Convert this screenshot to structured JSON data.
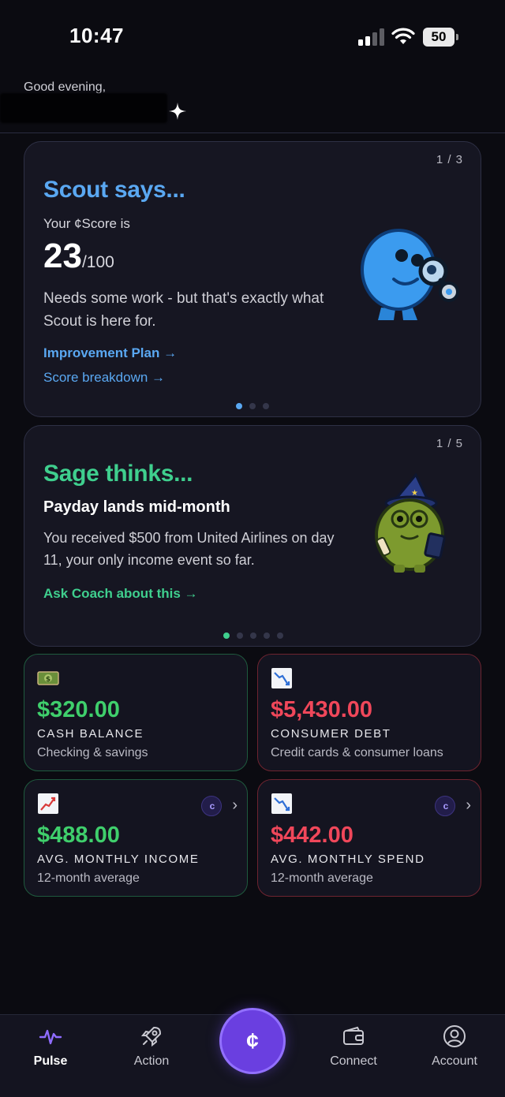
{
  "status_bar": {
    "time": "10:47",
    "battery": "50"
  },
  "header": {
    "greeting": "Good evening,"
  },
  "scout_card": {
    "counter": "1 / 3",
    "heading": "Scout says...",
    "score_label": "Your ¢Score is",
    "score_value": "23",
    "score_max": "/100",
    "description": "Needs some work - but that's exactly what Scout is here for.",
    "link_plan": "Improvement Plan →",
    "link_breakdown": "Score breakdown →",
    "accent": "#5aa8f2"
  },
  "sage_card": {
    "counter": "1 / 5",
    "heading": "Sage thinks...",
    "subtitle": "Payday lands mid-month",
    "description": "You received $500 from United Airlines on day 11, your only income event so far.",
    "link": "Ask Coach about this →",
    "accent": "#3fcf8e"
  },
  "stats": [
    {
      "icon": "money-icon",
      "value": "$320.00",
      "title": "CASH BALANCE",
      "subtitle": "Checking & savings"
    },
    {
      "icon": "chart-decreasing-icon",
      "value": "$5,430.00",
      "title": "CONSUMER DEBT",
      "subtitle": "Credit cards & consumer loans"
    },
    {
      "icon": "chart-increasing-icon",
      "value": "$488.00",
      "title": "AVG. MONTHLY INCOME",
      "subtitle": "12-month average"
    },
    {
      "icon": "chart-decreasing-icon",
      "value": "$442.00",
      "title": "AVG. MONTHLY SPEND",
      "subtitle": "12-month average"
    }
  ],
  "tab_bar": {
    "pulse": "Pulse",
    "action": "Action",
    "center": "¢",
    "connect": "Connect",
    "account": "Account"
  }
}
